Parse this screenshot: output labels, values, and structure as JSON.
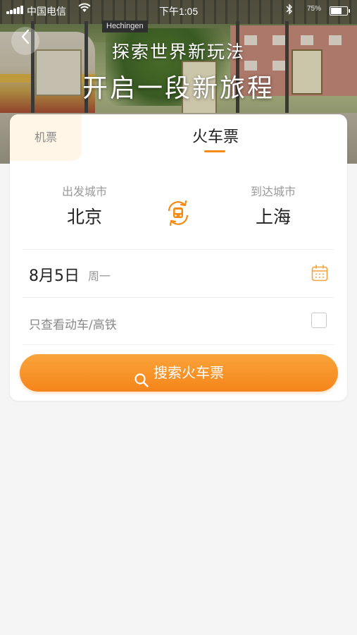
{
  "status_bar": {
    "carrier": "中国电信",
    "time": "下午1:05",
    "battery_text": "75%",
    "battery_level": 0.75
  },
  "hero": {
    "station_sign": "Hechingen",
    "title_line1": "探索世界新玩法",
    "title_line2": "开启一段新旅程"
  },
  "tabs": [
    {
      "label": "机票",
      "active": false
    },
    {
      "label": "火车票",
      "active": true
    }
  ],
  "departure": {
    "label": "出发城市",
    "city": "北京"
  },
  "arrival": {
    "label": "到达城市",
    "city": "上海"
  },
  "date": {
    "value": "8月5日",
    "weekday": "周一"
  },
  "hsr_filter": {
    "label": "只查看动车/高铁",
    "checked": false
  },
  "search_button": {
    "label": "搜索火车票"
  },
  "colors": {
    "accent": "#f5851a",
    "accent_light": "#f9a43a",
    "tab_inactive_bg": "#fff6e8",
    "page_bg": "#f5f5f5"
  },
  "icons": [
    "back-icon",
    "signal-icon",
    "wifi-icon",
    "bluetooth-icon",
    "battery-icon",
    "swap-train-icon",
    "calendar-icon",
    "search-icon"
  ]
}
